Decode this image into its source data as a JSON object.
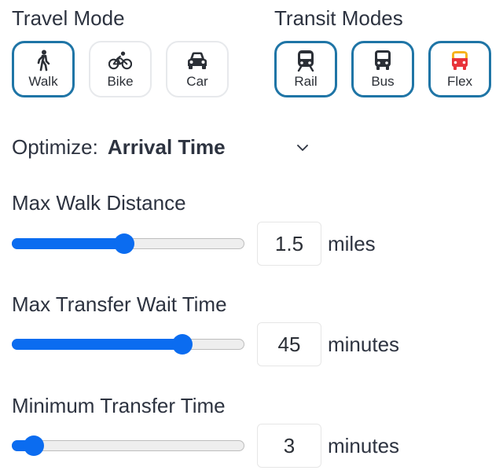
{
  "travel_mode": {
    "title": "Travel Mode",
    "buttons": [
      {
        "label": "Walk",
        "icon": "walk-icon",
        "selected": true
      },
      {
        "label": "Bike",
        "icon": "bike-icon",
        "selected": false
      },
      {
        "label": "Car",
        "icon": "car-icon",
        "selected": false
      }
    ]
  },
  "transit_modes": {
    "title": "Transit Modes",
    "buttons": [
      {
        "label": "Rail",
        "icon": "rail-icon",
        "selected": true
      },
      {
        "label": "Bus",
        "icon": "bus-icon",
        "selected": true
      },
      {
        "label": "Flex",
        "icon": "flex-icon",
        "selected": true
      }
    ]
  },
  "optimize": {
    "label": "Optimize:",
    "value": "Arrival Time"
  },
  "sliders": [
    {
      "title": "Max Walk Distance",
      "value": "1.5",
      "unit": "miles",
      "fill_fraction": 0.48
    },
    {
      "title": "Max Transfer Wait Time",
      "value": "45",
      "unit": "minutes",
      "fill_fraction": 0.73
    },
    {
      "title": "Minimum Transfer Time",
      "value": "3",
      "unit": "minutes",
      "fill_fraction": 0.09
    }
  ],
  "colors": {
    "selected_border": "#1f75a6",
    "slider_accent": "#0b6cf0",
    "flex_icon_red": "#e8333a",
    "flex_icon_yellow": "#f6b21b"
  }
}
